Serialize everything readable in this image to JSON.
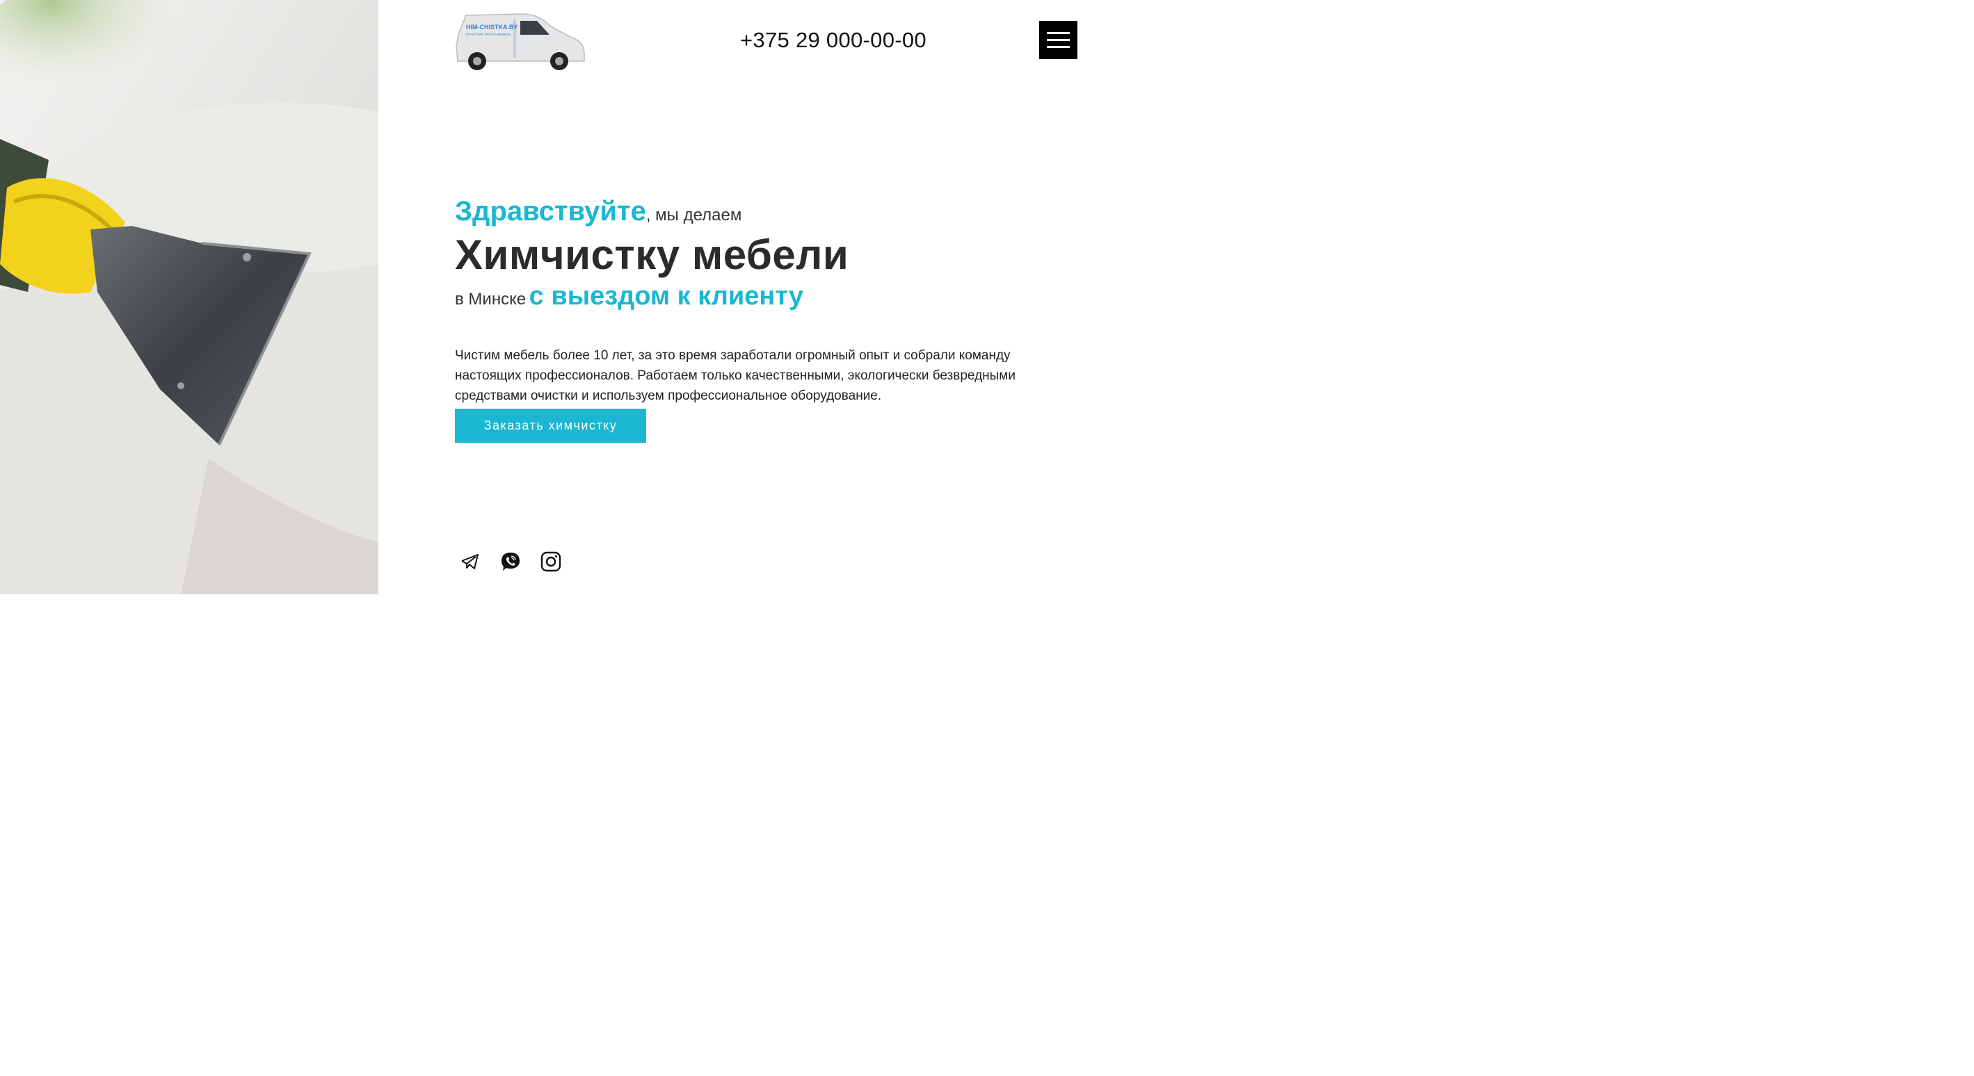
{
  "header": {
    "logo": {
      "brand_text": "HIM-CHISTKA.BY",
      "tagline": "ОТЧИСТИМ ЛЮБУЮ МЕБЕЛЬ",
      "icon": "delivery-van-logo"
    },
    "phone": "+375 29 000-00-00",
    "menu_icon": "hamburger-menu-icon"
  },
  "hero": {
    "image_icon": "upholstery-cleaning-nozzle-photo",
    "greeting_accent": "Здравствуйте",
    "greeting_rest": ", мы делаем",
    "headline": "Химчистку мебели",
    "location_text": "в Минске",
    "location_accent": "с выездом к клиенту",
    "description": "Чистим мебель более 10 лет, за это время заработали огромный опыт и собрали команду настоящих профессионалов. Работаем только качественными, экологически безвредными средствами очистки и используем профессиональное оборудование.",
    "cta_label": "Заказать химчистку"
  },
  "socials": [
    {
      "icon": "telegram-icon"
    },
    {
      "icon": "viber-icon"
    },
    {
      "icon": "instagram-icon"
    }
  ],
  "colors": {
    "accent": "#1ab6d2",
    "text_dark": "#2b2b2b",
    "menu_bg": "#000000"
  }
}
